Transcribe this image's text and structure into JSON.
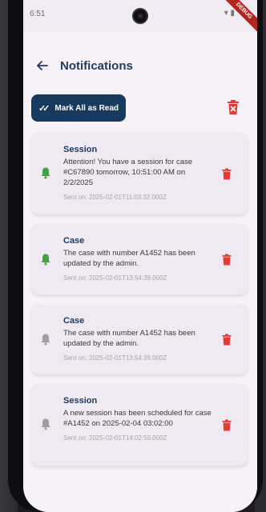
{
  "status_bar": {
    "time": "6:51",
    "debug_label": "DEBUG"
  },
  "header": {
    "title": "Notifications"
  },
  "toolbar": {
    "mark_all_label": "Mark All as Read"
  },
  "colors": {
    "primary": "#183a5f",
    "delete": "#e53935",
    "bell_unread": "#43a047",
    "bell_read": "#9e9e9e",
    "card": "#efe9f2"
  },
  "notifications": [
    {
      "title": "Session",
      "message": "Attention! You have a session for case #C67890 tomorrow, 10:51:00 AM on 2/2/2025",
      "sent": "Sent on: 2025-02-01T11:03:32.000Z",
      "read": false,
      "icon": "bell-icon"
    },
    {
      "title": "Case",
      "message": "The case with number A1452 has been updated by the admin.",
      "sent": "Sent on: 2025-02-01T13:54:39.000Z",
      "read": false,
      "icon": "bell-icon"
    },
    {
      "title": "Case",
      "message": "The case with number A1452 has been updated by the admin.",
      "sent": "Sent on: 2025-02-01T13:54:39.000Z",
      "read": true,
      "icon": "bell-icon"
    },
    {
      "title": "Session",
      "message": "A new session has been scheduled for case #A1452 on 2025-02-04 03:02:00",
      "sent": "Sent on: 2025-02-01T14:02:50.000Z",
      "read": true,
      "icon": "bell-icon"
    }
  ]
}
